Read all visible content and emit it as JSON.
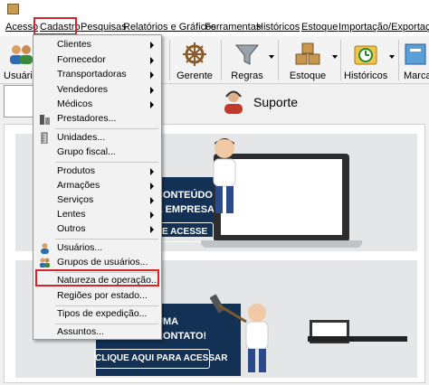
{
  "menubar": {
    "items": [
      "Acesso",
      "Cadastro",
      "Pesquisas",
      "Relatórios e Gráficos",
      "Ferramentas",
      "Históricos",
      "Estoque",
      "Importação/Exportação"
    ]
  },
  "toolbar": {
    "buttons": [
      "Usuário",
      "Gerente",
      "Regras",
      "Estoque",
      "Históricos",
      "Marcad"
    ]
  },
  "tabs": {
    "support_label": "Suporte"
  },
  "cadastro_menu": {
    "items": [
      {
        "label": "Clientes",
        "submenu": true
      },
      {
        "label": "Fornecedor",
        "submenu": true
      },
      {
        "label": "Transportadoras",
        "submenu": true
      },
      {
        "label": "Vendedores",
        "submenu": true
      },
      {
        "label": "Médicos",
        "submenu": true
      },
      {
        "label": "Prestadores..."
      },
      {
        "label": "Unidades..."
      },
      {
        "label": "Grupo fiscal..."
      },
      {
        "label": "Produtos",
        "submenu": true
      },
      {
        "label": "Armações",
        "submenu": true
      },
      {
        "label": "Serviços",
        "submenu": true
      },
      {
        "label": "Lentes",
        "submenu": true
      },
      {
        "label": "Outros",
        "submenu": true
      },
      {
        "label": "Usuários..."
      },
      {
        "label": "Grupos de usuários..."
      },
      {
        "label": "Natureza de operação..."
      },
      {
        "label": "Regiões por estado..."
      },
      {
        "label": "Tipos de expedição..."
      },
      {
        "label": "Assuntos..."
      }
    ]
  },
  "banners": {
    "card1_line1": "CONTEÚDO",
    "card1_line2": "A EMPRESA!",
    "card1_cta": "E ACESSE",
    "card2_line1": "UMA",
    "card2_line2": "CONTATO!",
    "card2_cta": "CLIQUE AQUI PARA ACESSAR"
  },
  "colors": {
    "highlight": "#d6232a",
    "banner_blue": "#123155"
  }
}
